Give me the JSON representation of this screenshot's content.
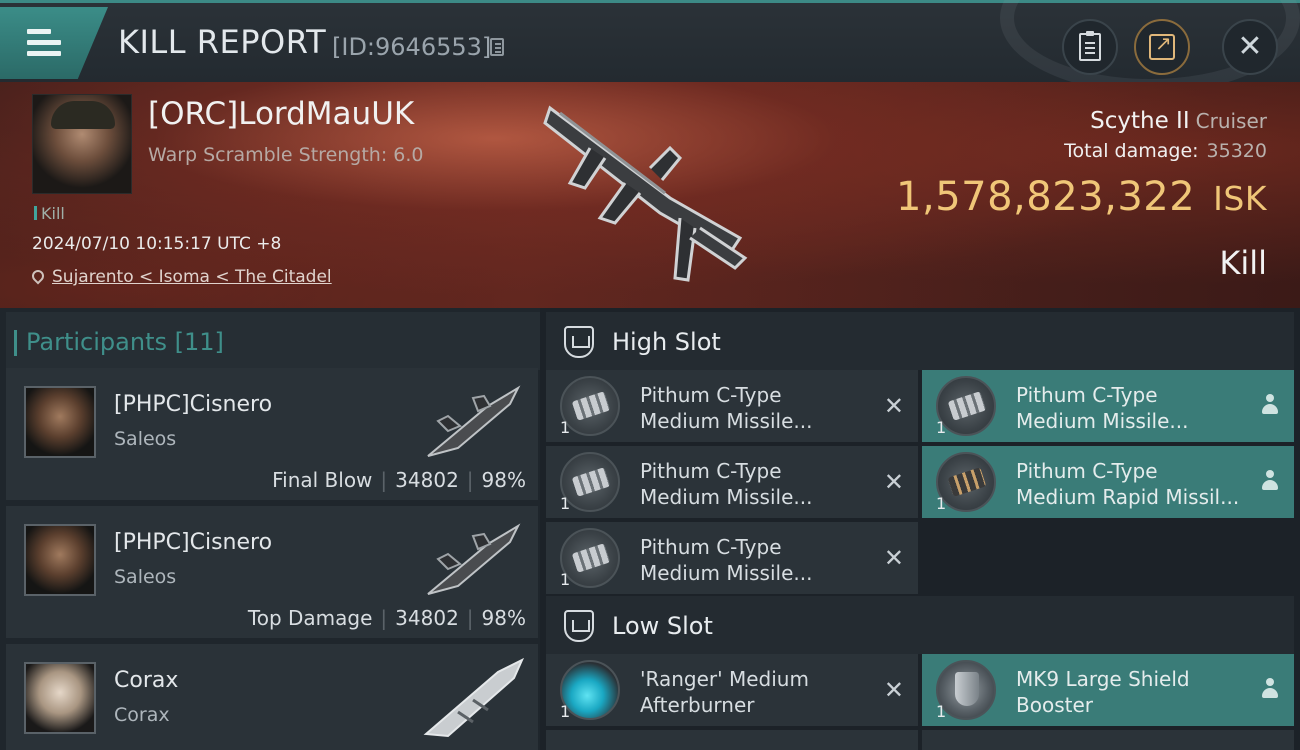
{
  "header": {
    "title": "KILL REPORT",
    "report_id": "[ID:9646553]"
  },
  "victim": {
    "name": "[ORC]LordMauUK",
    "scramble": "Warp Scramble Strength: 6.0",
    "tag": "Kill",
    "timestamp": "2024/07/10 10:15:17 UTC +8",
    "location": "Sujarento < Isoma < The Citadel",
    "ship": "Scythe II",
    "ship_class": "Cruiser",
    "damage_label": "Total damage:",
    "damage_value": "35320",
    "isk_value": "1,578,823,322",
    "isk_unit": "ISK",
    "result": "Kill"
  },
  "participants": {
    "header": "Participants [11]",
    "items": [
      {
        "name": "[PHPC]Cisnero",
        "ship": "Saleos",
        "role": "Final Blow",
        "damage": "34802",
        "percent": "98%"
      },
      {
        "name": "[PHPC]Cisnero",
        "ship": "Saleos",
        "role": "Top Damage",
        "damage": "34802",
        "percent": "98%"
      },
      {
        "name": "Corax",
        "ship": "Corax",
        "role": "",
        "damage": "",
        "percent": ""
      }
    ]
  },
  "fitting": {
    "high_slot": {
      "label": "High Slot",
      "modules": [
        {
          "name": "Pithum C-Type\nMedium Missile...",
          "qty": "1",
          "state": "destroyed"
        },
        {
          "name": "Pithum C-Type\nMedium Missile...",
          "qty": "1",
          "state": "dropped"
        },
        {
          "name": "Pithum C-Type\nMedium Missile...",
          "qty": "1",
          "state": "destroyed"
        },
        {
          "name": "Pithum C-Type\nMedium Rapid Missil...",
          "qty": "1",
          "state": "dropped"
        },
        {
          "name": "Pithum C-Type\nMedium Missile...",
          "qty": "1",
          "state": "destroyed"
        }
      ]
    },
    "low_slot": {
      "label": "Low Slot",
      "modules": [
        {
          "name": "'Ranger' Medium\nAfterburner",
          "qty": "1",
          "state": "destroyed"
        },
        {
          "name": "MK9 Large Shield\nBooster",
          "qty": "1",
          "state": "dropped"
        }
      ]
    }
  },
  "colors": {
    "accent": "#3f8f8a",
    "isk": "#f0c678",
    "fitted_bg": "#3a7c78"
  }
}
